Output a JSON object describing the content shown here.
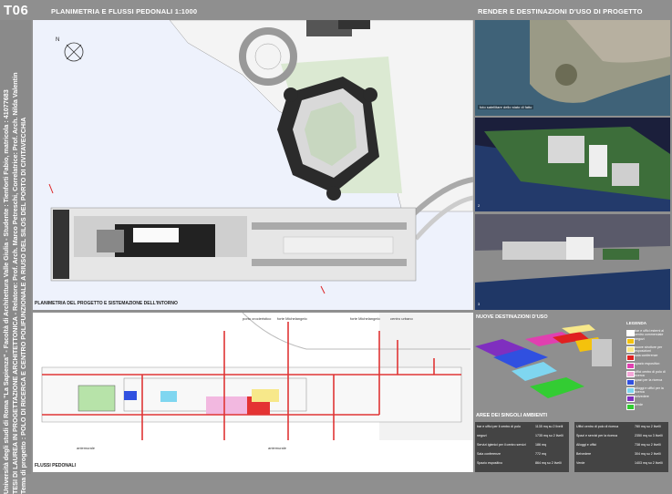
{
  "board": {
    "code": "T06",
    "title_plan": "PLANIMETRIA E FLUSSI PEDONALI 1:1000",
    "title_render": "RENDER E DESTINAZIONI D'USO DI PROGETTO",
    "vertical_lines": [
      "Università degli studi di Roma \"La Sapienza\" - Facoltà di Architettura Valle Giulia - Studente : Tienforti Fabio, matricola : 41077683",
      "TESI DI LAUREA IN PROGETTAZIONE ARCHITETTONICA - Relatore: Prof. Arch. Marco Petreschi, Correlatrice: Prof. Arch. Nilda Valentin",
      "Tema di progetto : POLO DI RICERCA E CENTRO POLIFUNZIONALE A RIUSO DEL SILOS DEL PORTO DI CIVITAVECCHIA"
    ]
  },
  "plan": {
    "caption": "PLANIMETRIA DEL PROGETTO E SISTEMAZIONE DELL'INTORNO"
  },
  "flows": {
    "caption": "FLUSSI PEDONALI",
    "labels": {
      "porto": "porto crocieristico",
      "forte1": "forte Michelangelo",
      "forte2": "forte Michelangelo",
      "centro": "centro urbano",
      "ant1": "antemurale",
      "ant2": "antemurale"
    }
  },
  "renders": {
    "caption1": "foto satellitare dello stato di fatto",
    "num2": "2",
    "num3": "3"
  },
  "destinations": {
    "title": "NUOVE DESTINAZIONI D'USO",
    "legend_title": "LEGENDA",
    "legend": [
      {
        "label": "bar e uffici esterni al centro commerciale",
        "color": "#ffffff"
      },
      {
        "label": "negozi",
        "color": "#f4c20d"
      },
      {
        "label": "nuove strutture per esposizioni",
        "color": "#f7e88a"
      },
      {
        "label": "sala conferenze",
        "color": "#e02020"
      },
      {
        "label": "spazio espositivo",
        "color": "#e040b0"
      },
      {
        "label": "uffici centro di polo di ricerca",
        "color": "#f4a6d8"
      },
      {
        "label": "spazi per la ricerca",
        "color": "#3050e0"
      },
      {
        "label": "alloggi e uffici per la ricerca",
        "color": "#7fd6f0"
      },
      {
        "label": "belvedere",
        "color": "#7f2fbf"
      },
      {
        "label": "verde",
        "color": "#33cc33"
      }
    ]
  },
  "areas": {
    "title": "AREE DEI SINGOLI AMBIENTI",
    "col1": [
      {
        "name": "bar e uffici per il centro di polo",
        "value": "1135 mq su 2 livelli"
      },
      {
        "name": "negozi",
        "value": "1735 mq su 2 livelli"
      },
      {
        "name": "Servizi igienici per il centro servizi",
        "value": "186 mq"
      },
      {
        "name": "Sala conferenze",
        "value": "772 mq"
      },
      {
        "name": "Spazio espositivo",
        "value": "864 mq su 2 livelli"
      }
    ],
    "col2": [
      {
        "name": "Uffici centro di polo di ricerca",
        "value": "780 mq su 2 livelli"
      },
      {
        "name": "Spazi e servizi per la ricerca",
        "value": "2350 mq su 3 livelli"
      },
      {
        "name": "Alloggi e uffici",
        "value": "738 mq su 2 livelli"
      },
      {
        "name": "Belvedere",
        "value": "304 mq su 2 livelli"
      },
      {
        "name": "Verde",
        "value": "1403 mq su 2 livelli"
      }
    ]
  },
  "colors": {
    "background": "#8f8f8f",
    "plan_bg": "#ffffff",
    "water": "#e8eefb",
    "flow_red": "#e03535",
    "legend_bg": "#555555"
  }
}
